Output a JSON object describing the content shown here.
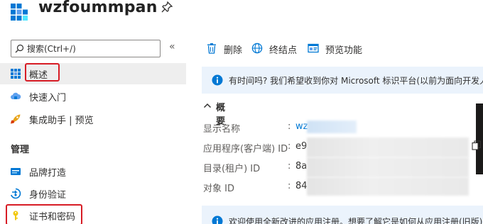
{
  "app": {
    "title": "wzfoummpan",
    "logo_icon": "app-registration-icon",
    "pin_icon": "pin-icon"
  },
  "sidebar": {
    "search": {
      "placeholder": "搜索(Ctrl+/)",
      "value": ""
    },
    "collapse_glyph": "«",
    "items": [
      {
        "label": "概述",
        "icon": "overview-grid-icon",
        "active": true
      },
      {
        "label": "快速入门",
        "icon": "quickstart-cloud-icon"
      },
      {
        "label": "集成助手 | 预览",
        "icon": "rocket-icon"
      }
    ],
    "sections": [
      {
        "title": "管理",
        "items": [
          {
            "label": "品牌打造",
            "icon": "branding-icon"
          },
          {
            "label": "身份验证",
            "icon": "authentication-icon"
          },
          {
            "label": "证书和密码",
            "icon": "key-icon",
            "highlighted": true
          }
        ]
      }
    ]
  },
  "toolbar": {
    "delete_label": "删除",
    "endpoints_label": "终结点",
    "preview_label": "预览功能"
  },
  "info_banner": {
    "text": "有时间吗? 我们希望收到你对 Microsoft 标识平台(以前为面向开发人"
  },
  "essentials": {
    "title": "概要",
    "rows": [
      {
        "key": "显示名称",
        "value": "wz"
      },
      {
        "key": "应用程序(客户端) ID",
        "value": "e9"
      },
      {
        "key": "目录(租户) ID",
        "value": "8a"
      },
      {
        "key": "对象 ID",
        "value": "84"
      }
    ]
  },
  "bottom_banner": {
    "text": "欢迎使用全新改进的应用注册。想要了解它是如何从应用注册(旧版)"
  },
  "colors": {
    "accent": "#0078d4",
    "highlight": "#d71c25",
    "banner_bg": "#ebf3fc",
    "active_bg": "#eeeeee"
  }
}
